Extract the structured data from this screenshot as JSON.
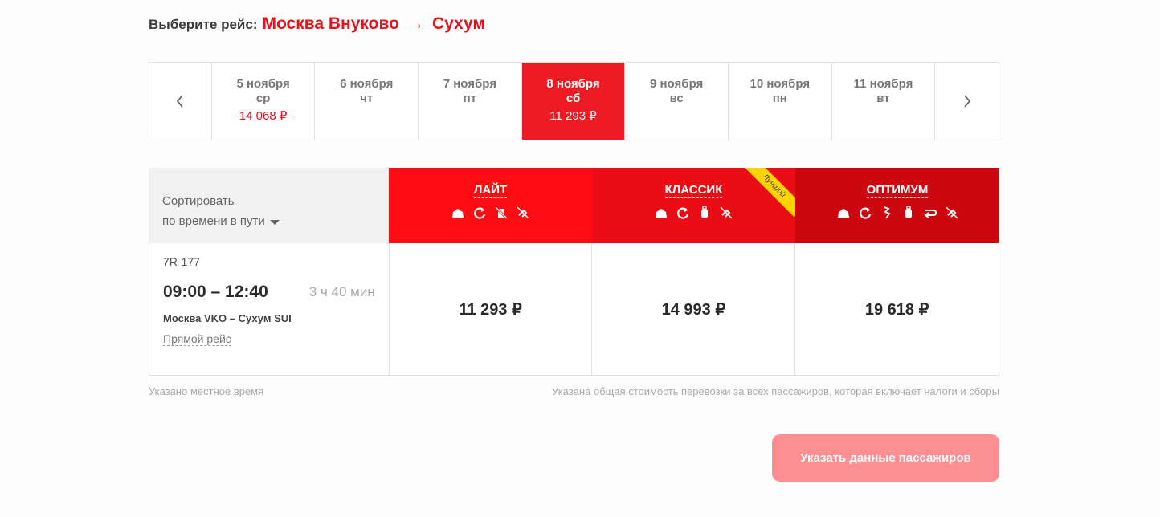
{
  "heading": {
    "label": "Выберите рейс:",
    "origin": "Москва Внуково",
    "arrow": "→",
    "destination": "Сухум"
  },
  "dates": [
    {
      "day": "5 ноября",
      "weekday": "ср",
      "price": "14 068 ₽",
      "active": false
    },
    {
      "day": "6 ноября",
      "weekday": "чт",
      "price": "",
      "active": false
    },
    {
      "day": "7 ноября",
      "weekday": "пт",
      "price": "",
      "active": false
    },
    {
      "day": "8 ноября",
      "weekday": "сб",
      "price": "11 293 ₽",
      "active": true
    },
    {
      "day": "9 ноября",
      "weekday": "вс",
      "price": "",
      "active": false
    },
    {
      "day": "10 ноября",
      "weekday": "пн",
      "price": "",
      "active": false
    },
    {
      "day": "11 ноября",
      "weekday": "вт",
      "price": "",
      "active": false
    }
  ],
  "sort": {
    "title": "Сортировать",
    "option": "по времени в пути"
  },
  "tariffs": [
    {
      "name": "ЛАЙТ",
      "icons": [
        "bag-icon",
        "exchange-icon",
        "no-luggage-icon",
        "no-return-icon"
      ]
    },
    {
      "name": "КЛАССИК",
      "badge": "Лучший",
      "icons": [
        "bag-icon",
        "exchange-icon",
        "luggage-icon",
        "no-return-icon"
      ]
    },
    {
      "name": "ОПТИМУМ",
      "icons": [
        "bag-icon",
        "exchange-icon",
        "seat-icon",
        "luggage-icon",
        "return-icon",
        "no-return-icon"
      ]
    }
  ],
  "flight": {
    "number": "7R-177",
    "time": "09:00 – 12:40",
    "duration": "3 ч 40 мин",
    "route": "Москва VKO – Сухум SUI",
    "type": "Прямой рейс",
    "prices": [
      "11 293 ₽",
      "14 993 ₽",
      "19 618 ₽"
    ]
  },
  "notes": {
    "left": "Указано местное время",
    "right": "Указана общая стоимость перевозки за всех пассажиров, которая включает налоги и сборы"
  },
  "cta": "Указать данные пассажиров",
  "colors": {
    "brand_red": "#ed1c24",
    "cta_disabled": "#fd8e91",
    "badge": "#ffd400"
  }
}
